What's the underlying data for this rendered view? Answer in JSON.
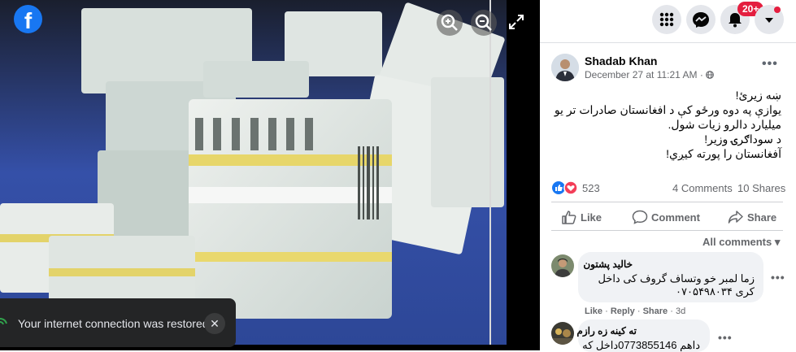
{
  "viewer": {
    "logo_letter": "f",
    "toast": {
      "text": "Your internet connection was restored.",
      "close_glyph": "✕"
    }
  },
  "topbar": {
    "notifications_badge": "20+",
    "icons": [
      "menu-grid-icon",
      "messenger-icon",
      "bell-icon",
      "caret-down-icon"
    ]
  },
  "post": {
    "author": "Shadab Khan",
    "date": "December 27 at 11:21 AM",
    "privacy_dot": "·",
    "more_glyph": "•••",
    "text_lines": [
      "ښه زيرئ!",
      "يوازې په دوه ورځو کې د افغانستان صادرات تر يو",
      "ميليارد دالرو زيات شول.",
      "د سوداګرۍ وزير!",
      "آفغانستان را پورته کيږي!"
    ],
    "reactions_count": "523",
    "comments_count": "4 Comments",
    "shares_count": "10 Shares",
    "actions": {
      "like": "Like",
      "comment": "Comment",
      "share": "Share"
    },
    "all_comments_label": "All comments ▾"
  },
  "comments": [
    {
      "name": "خالید پشتون",
      "lines": [
        "زما لمبر خو وتساف گروف کی داخل",
        "کری ۰۷۰۵۴۹۸۰۳۴"
      ],
      "actions": {
        "like": "Like",
        "reply": "Reply",
        "share": "Share",
        "time": "3d"
      }
    },
    {
      "name": "ته کينه زه رازم",
      "lines": [
        "داهم 0773855146داخل که"
      ]
    }
  ],
  "colors": {
    "fb_blue": "#1877f2",
    "badge_red": "#e41e3f",
    "toast_bg": "#242526"
  }
}
